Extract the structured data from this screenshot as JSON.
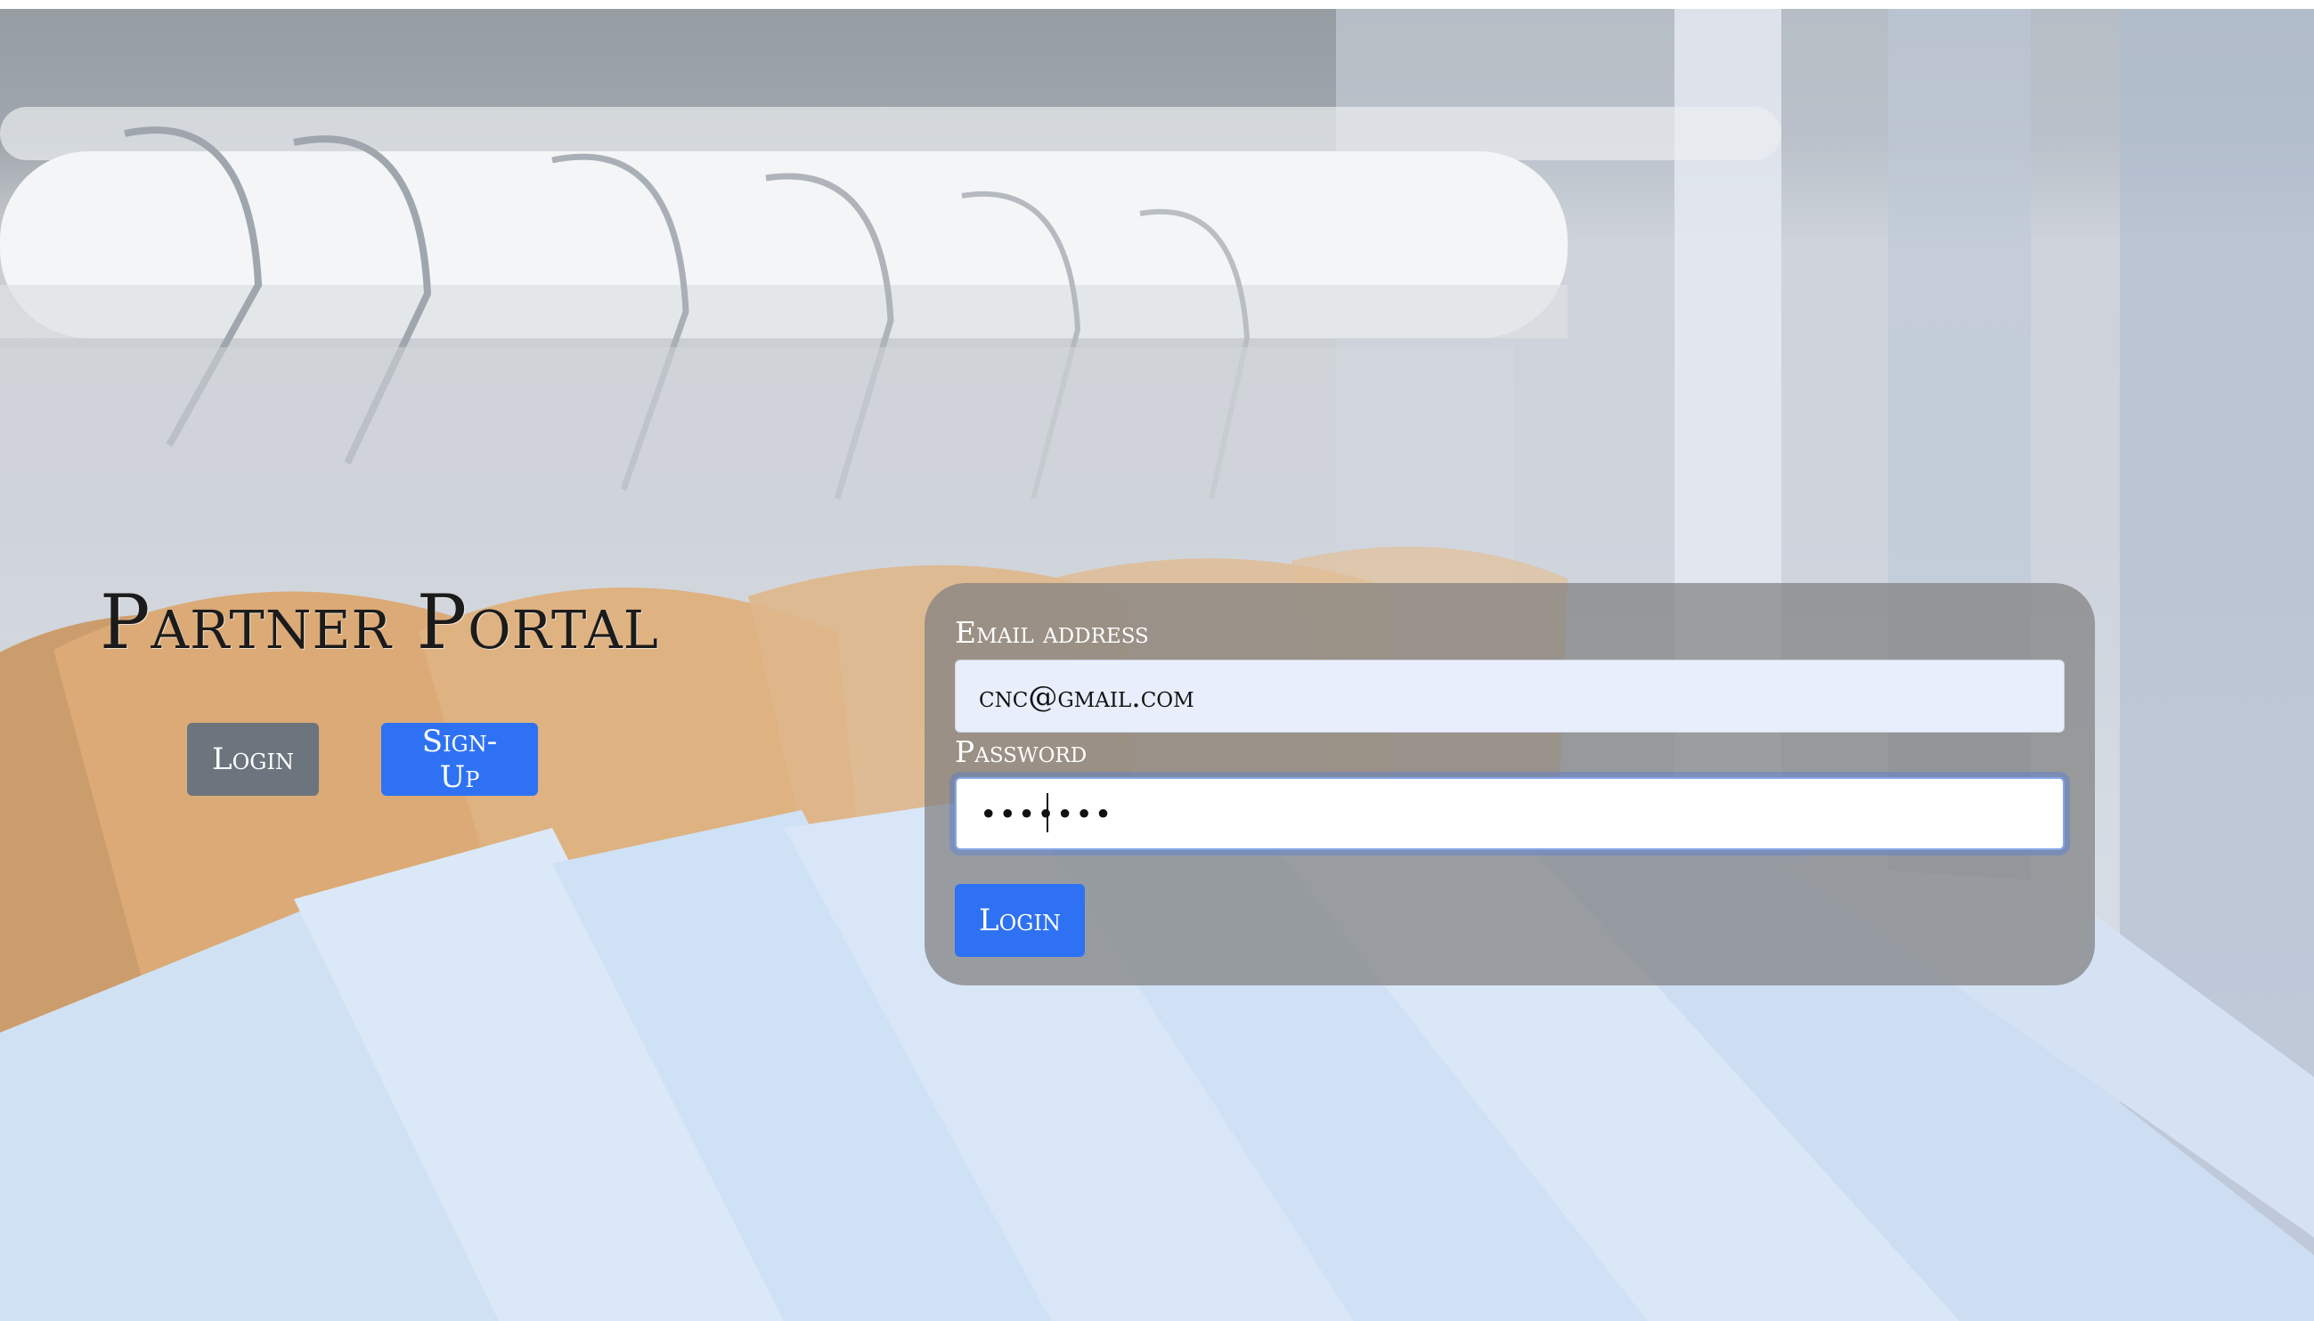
{
  "hero": {
    "title": "Partner Portal"
  },
  "nav": {
    "login_label": "Login",
    "signup_label": "Sign-Up"
  },
  "form": {
    "email_label": "Email address",
    "email_value": "cnc@gmail.com",
    "password_label": "Password",
    "password_value": "•••••••",
    "submit_label": "Login"
  },
  "colors": {
    "primary": "#2e72f3",
    "secondary": "#6c757d",
    "card": "#808080"
  }
}
